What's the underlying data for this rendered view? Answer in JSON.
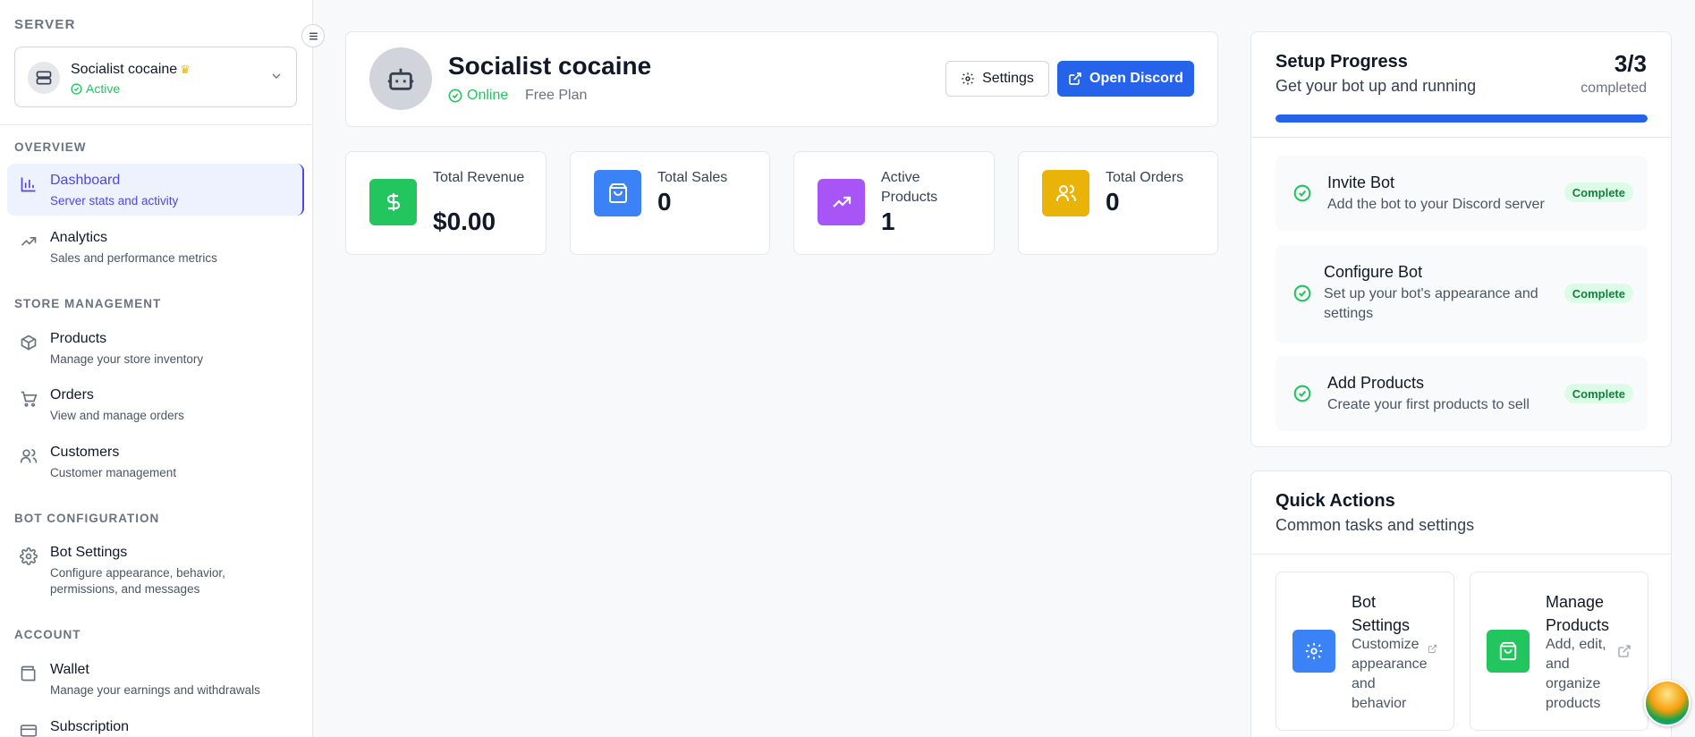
{
  "sidebar": {
    "server_label": "SERVER",
    "server": {
      "name": "Socialist cocaine",
      "status": "Active"
    },
    "sections": [
      "OVERVIEW",
      "STORE MANAGEMENT",
      "BOT CONFIGURATION",
      "ACCOUNT"
    ],
    "items": [
      {
        "title": "Dashboard",
        "desc": "Server stats and activity",
        "icon": "bar-chart-icon",
        "active": true
      },
      {
        "title": "Analytics",
        "desc": "Sales and performance metrics",
        "icon": "trending-up-icon"
      },
      {
        "title": "Products",
        "desc": "Manage your store inventory",
        "icon": "package-icon"
      },
      {
        "title": "Orders",
        "desc": "View and manage orders",
        "icon": "cart-icon"
      },
      {
        "title": "Customers",
        "desc": "Customer management",
        "icon": "users-icon"
      },
      {
        "title": "Bot Settings",
        "desc": "Configure appearance, behavior, permissions, and messages",
        "icon": "gear-icon"
      },
      {
        "title": "Wallet",
        "desc": "Manage your earnings and withdrawals",
        "icon": "wallet-icon"
      },
      {
        "title": "Subscription",
        "desc": "",
        "icon": "credit-card-icon"
      }
    ]
  },
  "header": {
    "title": "Socialist cocaine",
    "status": "Online",
    "plan": "Free Plan",
    "settings_label": "Settings",
    "discord_label": "Open Discord"
  },
  "stats": [
    {
      "label": "Total Revenue",
      "value": "$0.00",
      "color": "#22c55e",
      "icon": "dollar-icon"
    },
    {
      "label": "Total Sales",
      "value": "0",
      "color": "#3b82f6",
      "icon": "shopping-bag-icon"
    },
    {
      "label": "Active Products",
      "value": "1",
      "color": "#a855f7",
      "icon": "trending-up-icon"
    },
    {
      "label": "Total Orders",
      "value": "0",
      "color": "#eab308",
      "icon": "users-icon"
    }
  ],
  "setup": {
    "title": "Setup Progress",
    "subtitle": "Get your bot up and running",
    "count": "3/3",
    "completed_label": "completed",
    "progress": 1.0,
    "steps": [
      {
        "title": "Invite Bot",
        "desc": "Add the bot to your Discord server",
        "badge": "Complete"
      },
      {
        "title": "Configure Bot",
        "desc": "Set up your bot's appearance and settings",
        "badge": "Complete"
      },
      {
        "title": "Add Products",
        "desc": "Create your first products to sell",
        "badge": "Complete"
      }
    ]
  },
  "quick_actions": {
    "title": "Quick Actions",
    "subtitle": "Common tasks and settings",
    "items": [
      {
        "name": "Bot Settings",
        "desc": "Customize appearance and behavior",
        "color": "#3b82f6",
        "icon": "gear-icon"
      },
      {
        "name": "Manage Products",
        "desc": "Add, edit, and organize products",
        "color": "#22c55e",
        "icon": "shopping-bag-icon"
      }
    ]
  },
  "colors": {
    "accent": "#2563eb",
    "active_nav": "#4f46e5",
    "success": "#22c55e"
  }
}
